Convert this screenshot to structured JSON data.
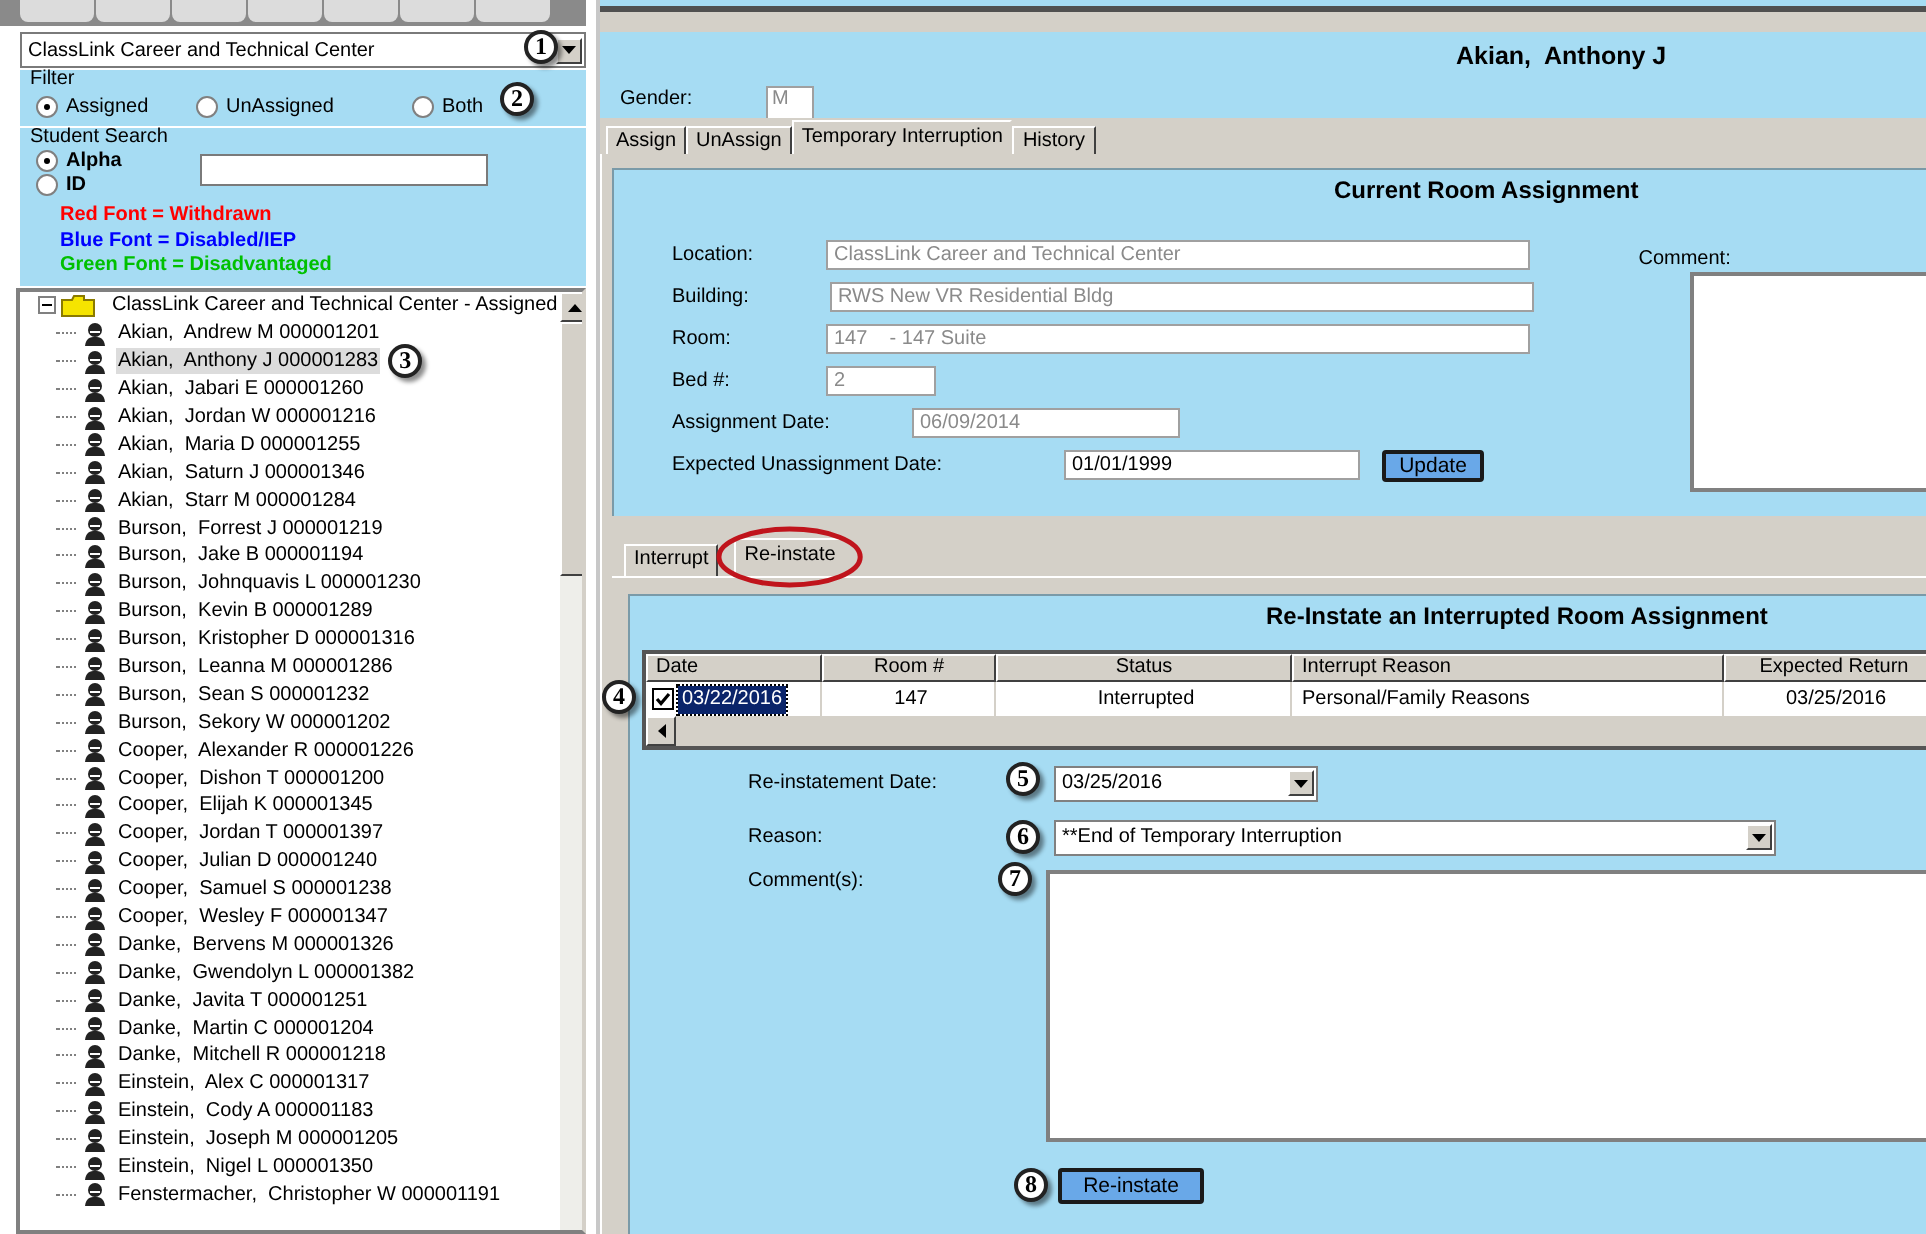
{
  "school_select": {
    "value": "ClassLink Career and Technical Center",
    "callout": "1"
  },
  "filter": {
    "title": "Filter",
    "callout": "2",
    "options": [
      {
        "label": "Assigned",
        "selected": true
      },
      {
        "label": "UnAssigned",
        "selected": false
      },
      {
        "label": "Both",
        "selected": false
      }
    ]
  },
  "student_search": {
    "title": "Student Search",
    "modes": [
      {
        "label": "Alpha",
        "selected": true
      },
      {
        "label": "ID",
        "selected": false
      }
    ],
    "legend": [
      {
        "text": "Red Font = Withdrawn",
        "color": "#ff0000"
      },
      {
        "text": "Blue Font = Disabled/IEP",
        "color": "#0000ff"
      },
      {
        "text": "Green Font = Disadvantaged",
        "color": "#00c000"
      }
    ]
  },
  "tree": {
    "label": "ClassLink Career and Technical Center - Assigned",
    "expanded": true,
    "callout": "3",
    "children": [
      {
        "label": "Akian,  Andrew M 000001201",
        "selected": false
      },
      {
        "label": "Akian,  Anthony J 000001283",
        "selected": true
      },
      {
        "label": "Akian,  Jabari E 000001260",
        "selected": false
      },
      {
        "label": "Akian,  Jordan W 000001216",
        "selected": false
      },
      {
        "label": "Akian,  Maria D 000001255",
        "selected": false
      },
      {
        "label": "Akian,  Saturn J 000001346",
        "selected": false
      },
      {
        "label": "Akian,  Starr M 000001284",
        "selected": false
      },
      {
        "label": "Burson,  Forrest J 000001219",
        "selected": false
      },
      {
        "label": "Burson,  Jake B 000001194",
        "selected": false
      },
      {
        "label": "Burson,  Johnquavis L 000001230",
        "selected": false
      },
      {
        "label": "Burson,  Kevin B 000001289",
        "selected": false
      },
      {
        "label": "Burson,  Kristopher D 000001316",
        "selected": false
      },
      {
        "label": "Burson,  Leanna M 000001286",
        "selected": false
      },
      {
        "label": "Burson,  Sean S 000001232",
        "selected": false
      },
      {
        "label": "Burson,  Sekory W 000001202",
        "selected": false
      },
      {
        "label": "Cooper,  Alexander R 000001226",
        "selected": false
      },
      {
        "label": "Cooper,  Dishon T 000001200",
        "selected": false
      },
      {
        "label": "Cooper,  Elijah K 000001345",
        "selected": false
      },
      {
        "label": "Cooper,  Jordan T 000001397",
        "selected": false
      },
      {
        "label": "Cooper,  Julian D 000001240",
        "selected": false
      },
      {
        "label": "Cooper,  Samuel S 000001238",
        "selected": false
      },
      {
        "label": "Cooper,  Wesley F 000001347",
        "selected": false
      },
      {
        "label": "Danke,  Bervens M 000001326",
        "selected": false
      },
      {
        "label": "Danke,  Gwendolyn L 000001382",
        "selected": false
      },
      {
        "label": "Danke,  Javita T 000001251",
        "selected": false
      },
      {
        "label": "Danke,  Martin C 000001204",
        "selected": false
      },
      {
        "label": "Danke,  Mitchell R 000001218",
        "selected": false
      },
      {
        "label": "Einstein,  Alex C 000001317",
        "selected": false
      },
      {
        "label": "Einstein,  Cody A 000001183",
        "selected": false
      },
      {
        "label": "Einstein,  Joseph M 000001205",
        "selected": false
      },
      {
        "label": "Einstein,  Nigel L 000001350",
        "selected": false
      },
      {
        "label": "Fenstermacher,  Christopher W 000001191",
        "selected": false
      }
    ]
  },
  "student_name": "Akian,  Anthony J",
  "gender": {
    "label": "Gender:",
    "value": "M"
  },
  "tabs": [
    {
      "label": "Assign",
      "selected": false
    },
    {
      "label": "UnAssign",
      "selected": false
    },
    {
      "label": "Temporary Interruption",
      "selected": true
    },
    {
      "label": "History",
      "selected": false
    }
  ],
  "current_assignment": {
    "title": "Current Room Assignment",
    "update_button": "Update",
    "comment_label": "Comment:",
    "fields": [
      {
        "label": "Location:",
        "value": "ClassLink Career and Technical Center",
        "disabled": true
      },
      {
        "label": "Building:",
        "value": "RWS New VR Residential Bldg",
        "disabled": true
      },
      {
        "label": "Room:",
        "value": "147    - 147 Suite",
        "disabled": true
      },
      {
        "label": "Bed #:",
        "value": "2",
        "disabled": true
      },
      {
        "label": "Assignment Date:",
        "value": "06/09/2014",
        "disabled": true
      },
      {
        "label": "Expected Unassignment Date:",
        "value": "01/01/1999",
        "disabled": false
      }
    ]
  },
  "sub_tabs": [
    {
      "label": "Interrupt",
      "selected": false,
      "highlighted": false
    },
    {
      "label": "Re-instate",
      "selected": true,
      "highlighted": true
    }
  ],
  "reinstate": {
    "title": "Re-Instate an Interrupted Room Assignment",
    "table": {
      "callout": "4",
      "columns": [
        "Date",
        "Room #",
        "Status",
        "Interrupt Reason",
        "Expected Return"
      ],
      "rows": [
        {
          "checked": true,
          "selected": true,
          "cells": [
            "03/22/2016",
            "147",
            "Interrupted",
            "Personal/Family Reasons",
            "03/25/2016"
          ]
        }
      ]
    },
    "date": {
      "label": "Re-instatement Date:",
      "value": "03/25/2016",
      "callout": "5"
    },
    "reason": {
      "label": "Reason:",
      "value": "**End of Temporary Interruption",
      "callout": "6"
    },
    "comments": {
      "label": "Comment(s):",
      "callout": "7"
    },
    "button": {
      "label": "Re-instate",
      "callout": "8"
    }
  }
}
